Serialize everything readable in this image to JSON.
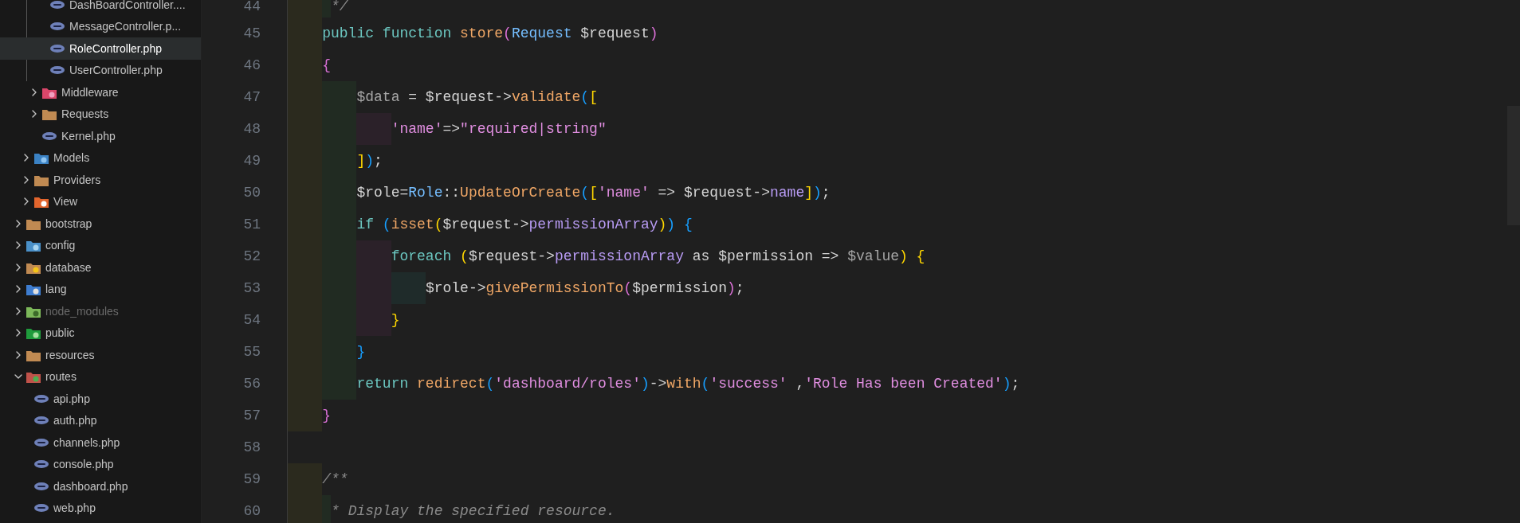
{
  "explorer": {
    "tree": [
      {
        "children": [
          {
            "children": [
              {
                "children": [
                  {
                    "label": "DashBoardController....",
                    "kind": "php",
                    "selected": false,
                    "ignored": false
                  },
                  {
                    "label": "MessageController.p...",
                    "kind": "php",
                    "selected": false,
                    "ignored": false
                  },
                  {
                    "label": "RoleController.php",
                    "kind": "php",
                    "selected": true,
                    "ignored": false
                  },
                  {
                    "label": "UserController.php",
                    "kind": "php",
                    "selected": false,
                    "ignored": false
                  }
                ]
              },
              {
                "label": "Middleware",
                "kind": "middleware",
                "expanded": false,
                "selected": false,
                "ignored": false
              },
              {
                "label": "Requests",
                "kind": "folder",
                "expanded": false,
                "selected": false,
                "ignored": false
              },
              {
                "label": "Kernel.php",
                "kind": "php",
                "selected": false,
                "ignored": false
              }
            ]
          },
          {
            "label": "Models",
            "kind": "models",
            "expanded": false,
            "selected": false,
            "ignored": false
          },
          {
            "label": "Providers",
            "kind": "folder",
            "expanded": false,
            "selected": false,
            "ignored": false
          },
          {
            "label": "View",
            "kind": "view",
            "expanded": false,
            "selected": false,
            "ignored": false
          }
        ]
      },
      {
        "label": "bootstrap",
        "kind": "folder",
        "expanded": false,
        "selected": false,
        "ignored": false
      },
      {
        "label": "config",
        "kind": "config",
        "expanded": false,
        "selected": false,
        "ignored": false
      },
      {
        "label": "database",
        "kind": "database",
        "expanded": false,
        "selected": false,
        "ignored": false
      },
      {
        "label": "lang",
        "kind": "lang",
        "expanded": false,
        "selected": false,
        "ignored": false
      },
      {
        "label": "node_modules",
        "kind": "node",
        "expanded": false,
        "selected": false,
        "ignored": true
      },
      {
        "label": "public",
        "kind": "public",
        "expanded": false,
        "selected": false,
        "ignored": false
      },
      {
        "label": "resources",
        "kind": "folder",
        "expanded": false,
        "selected": false,
        "ignored": false
      },
      {
        "label": "routes",
        "kind": "routes",
        "expanded": true,
        "selected": false,
        "ignored": false,
        "children": [
          {
            "label": "api.php",
            "kind": "php",
            "selected": false,
            "ignored": false
          },
          {
            "label": "auth.php",
            "kind": "php",
            "selected": false,
            "ignored": false
          },
          {
            "label": "channels.php",
            "kind": "php",
            "selected": false,
            "ignored": false
          },
          {
            "label": "console.php",
            "kind": "php",
            "selected": false,
            "ignored": false
          },
          {
            "label": "dashboard.php",
            "kind": "php",
            "selected": false,
            "ignored": false
          },
          {
            "label": "web.php",
            "kind": "php",
            "selected": false,
            "ignored": false
          }
        ]
      }
    ]
  },
  "editor": {
    "lines": [
      {
        "number": "44",
        "kind": "comment",
        "tokens": [
          {
            "text": "     */",
            "color": "#8a8a8a"
          }
        ]
      },
      {
        "number": "45",
        "kind": "code",
        "tokens": [
          {
            "text": "    public function ",
            "color": "#6cc7c1"
          },
          {
            "text": "store",
            "color": "#f0a766"
          },
          {
            "text": "(",
            "color": "#da70d6"
          },
          {
            "text": "Request",
            "color": "#75beff"
          },
          {
            "text": " $request",
            "color": "#d4d4d4"
          },
          {
            "text": ")",
            "color": "#da70d6"
          }
        ]
      },
      {
        "number": "46",
        "kind": "code",
        "tokens": [
          {
            "text": "    {",
            "color": "#da70d6"
          }
        ]
      },
      {
        "number": "47",
        "kind": "code",
        "tokens": [
          {
            "text": "        $data",
            "color": "#a6a6a6"
          },
          {
            "text": " = $request->",
            "color": "#d4d4d4"
          },
          {
            "text": "validate",
            "color": "#f0a766"
          },
          {
            "text": "(",
            "color": "#179fff"
          },
          {
            "text": "[",
            "color": "#ffd700"
          }
        ]
      },
      {
        "number": "48",
        "kind": "code",
        "tokens": [
          {
            "text": "            'name'",
            "color": "#e08ee0"
          },
          {
            "text": "=>",
            "color": "#d4d4d4"
          },
          {
            "text": "\"required|string\"",
            "color": "#e08ee0"
          }
        ]
      },
      {
        "number": "49",
        "kind": "code",
        "tokens": [
          {
            "text": "        ]",
            "color": "#ffd700"
          },
          {
            "text": ")",
            "color": "#179fff"
          },
          {
            "text": ";",
            "color": "#d4d4d4"
          }
        ]
      },
      {
        "number": "50",
        "kind": "code",
        "tokens": [
          {
            "text": "        $role=",
            "color": "#d4d4d4"
          },
          {
            "text": "Role",
            "color": "#75beff"
          },
          {
            "text": "::",
            "color": "#d4d4d4"
          },
          {
            "text": "UpdateOrCreate",
            "color": "#f0a766"
          },
          {
            "text": "(",
            "color": "#179fff"
          },
          {
            "text": "[",
            "color": "#ffd700"
          },
          {
            "text": "'name'",
            "color": "#e08ee0"
          },
          {
            "text": " => $request->",
            "color": "#d4d4d4"
          },
          {
            "text": "name",
            "color": "#b99cf5"
          },
          {
            "text": "]",
            "color": "#ffd700"
          },
          {
            "text": ")",
            "color": "#179fff"
          },
          {
            "text": ";",
            "color": "#d4d4d4"
          }
        ]
      },
      {
        "number": "51",
        "kind": "code",
        "tokens": [
          {
            "text": "        if ",
            "color": "#6cc7c1"
          },
          {
            "text": "(",
            "color": "#179fff"
          },
          {
            "text": "isset",
            "color": "#f0a766"
          },
          {
            "text": "(",
            "color": "#ffd700"
          },
          {
            "text": "$request->",
            "color": "#d4d4d4"
          },
          {
            "text": "permissionArray",
            "color": "#b99cf5"
          },
          {
            "text": ")",
            "color": "#ffd700"
          },
          {
            "text": ")",
            "color": "#179fff"
          },
          {
            "text": " {",
            "color": "#179fff"
          }
        ]
      },
      {
        "number": "52",
        "kind": "code",
        "tokens": [
          {
            "text": "            foreach ",
            "color": "#6cc7c1"
          },
          {
            "text": "(",
            "color": "#ffd700"
          },
          {
            "text": "$request->",
            "color": "#d4d4d4"
          },
          {
            "text": "permissionArray",
            "color": "#b99cf5"
          },
          {
            "text": " as $permission => ",
            "color": "#d4d4d4"
          },
          {
            "text": "$value",
            "color": "#a6a6a6"
          },
          {
            "text": ")",
            "color": "#ffd700"
          },
          {
            "text": " {",
            "color": "#ffd700"
          }
        ]
      },
      {
        "number": "53",
        "kind": "code",
        "tokens": [
          {
            "text": "                $role->",
            "color": "#d4d4d4"
          },
          {
            "text": "givePermissionTo",
            "color": "#f0a766"
          },
          {
            "text": "(",
            "color": "#da70d6"
          },
          {
            "text": "$permission",
            "color": "#d4d4d4"
          },
          {
            "text": ")",
            "color": "#da70d6"
          },
          {
            "text": ";",
            "color": "#d4d4d4"
          }
        ]
      },
      {
        "number": "54",
        "kind": "code",
        "tokens": [
          {
            "text": "            }",
            "color": "#ffd700"
          }
        ]
      },
      {
        "number": "55",
        "kind": "code",
        "tokens": [
          {
            "text": "        }",
            "color": "#179fff"
          }
        ]
      },
      {
        "number": "56",
        "kind": "code",
        "tokens": [
          {
            "text": "        return ",
            "color": "#6cc7c1"
          },
          {
            "text": "redirect",
            "color": "#f0a766"
          },
          {
            "text": "(",
            "color": "#179fff"
          },
          {
            "text": "'dashboard/roles'",
            "color": "#e08ee0"
          },
          {
            "text": ")",
            "color": "#179fff"
          },
          {
            "text": "->",
            "color": "#d4d4d4"
          },
          {
            "text": "with",
            "color": "#f0a766"
          },
          {
            "text": "(",
            "color": "#179fff"
          },
          {
            "text": "'success'",
            "color": "#e08ee0"
          },
          {
            "text": " ,",
            "color": "#d4d4d4"
          },
          {
            "text": "'Role Has been Created'",
            "color": "#e08ee0"
          },
          {
            "text": ")",
            "color": "#179fff"
          },
          {
            "text": ";",
            "color": "#d4d4d4"
          }
        ]
      },
      {
        "number": "57",
        "kind": "code",
        "tokens": [
          {
            "text": "    }",
            "color": "#da70d6"
          }
        ]
      },
      {
        "number": "58",
        "kind": "blank"
      },
      {
        "number": "59",
        "kind": "comment",
        "tokens": [
          {
            "text": "    /**",
            "color": "#8a8a8a"
          }
        ]
      },
      {
        "number": "60",
        "kind": "comment",
        "tokens": [
          {
            "text": "     * Display the specified resource.",
            "color": "#8a8a8a"
          }
        ]
      }
    ]
  }
}
